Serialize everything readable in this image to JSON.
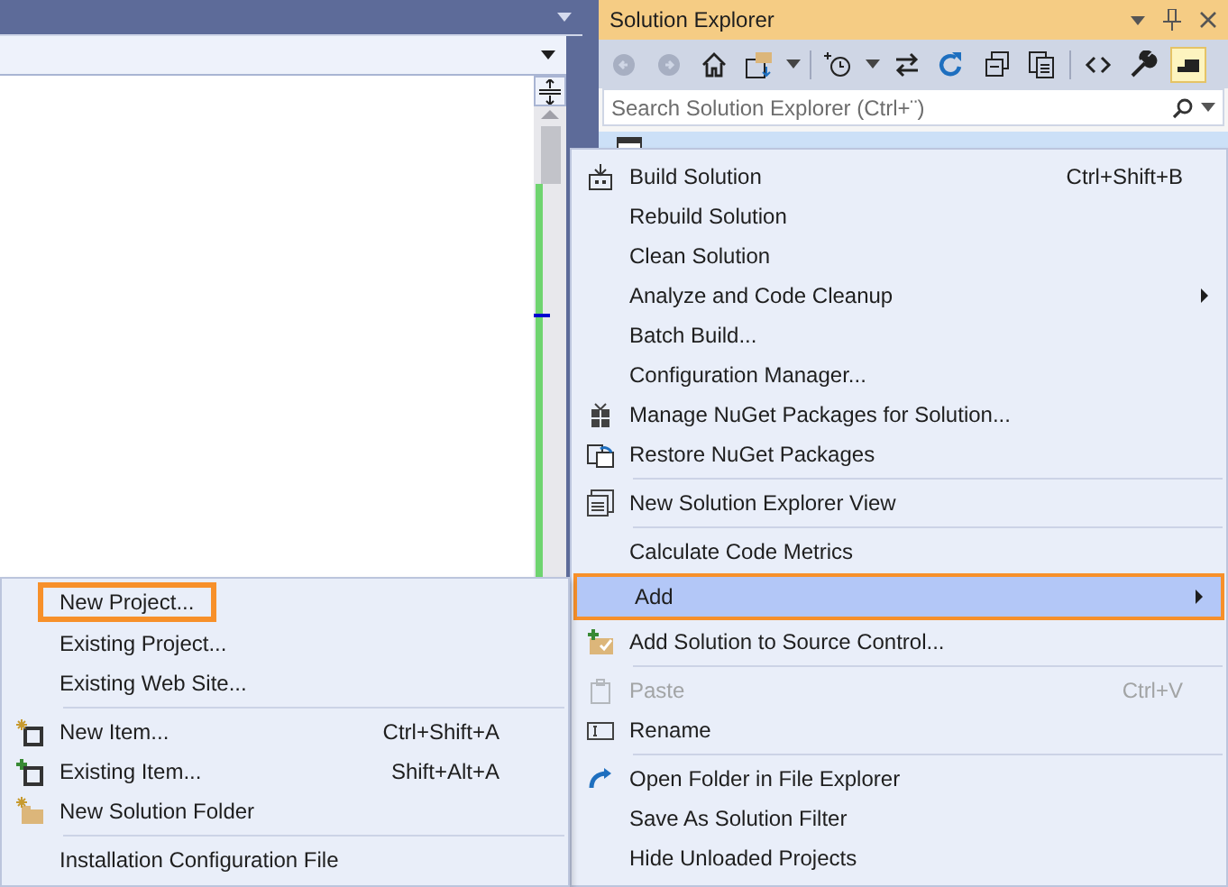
{
  "solution_explorer": {
    "title": "Solution Explorer",
    "search": {
      "placeholder": "Search Solution Explorer (Ctrl+¨)"
    }
  },
  "context_menu": [
    {
      "kind": "item",
      "label": "Build Solution",
      "shortcut": "Ctrl+Shift+B",
      "submenu": false,
      "disabled": false,
      "selected": false,
      "highlighted": false
    },
    {
      "kind": "item",
      "label": "Rebuild Solution",
      "submenu": false,
      "disabled": false,
      "selected": false,
      "highlighted": false
    },
    {
      "kind": "item",
      "label": "Clean Solution",
      "submenu": false,
      "disabled": false,
      "selected": false,
      "highlighted": false
    },
    {
      "kind": "item",
      "label": "Analyze and Code Cleanup",
      "submenu": true,
      "disabled": false,
      "selected": false,
      "highlighted": false
    },
    {
      "kind": "item",
      "label": "Batch Build...",
      "submenu": false,
      "disabled": false,
      "selected": false,
      "highlighted": false
    },
    {
      "kind": "item",
      "label": "Configuration Manager...",
      "submenu": false,
      "disabled": false,
      "selected": false,
      "highlighted": false
    },
    {
      "kind": "item",
      "label": "Manage NuGet Packages for Solution...",
      "submenu": false,
      "disabled": false,
      "selected": false,
      "highlighted": false
    },
    {
      "kind": "item",
      "label": "Restore NuGet Packages",
      "submenu": false,
      "disabled": false,
      "selected": false,
      "highlighted": false
    },
    {
      "kind": "separator"
    },
    {
      "kind": "item",
      "label": "New Solution Explorer View",
      "submenu": false,
      "disabled": false,
      "selected": false,
      "highlighted": false
    },
    {
      "kind": "separator"
    },
    {
      "kind": "item",
      "label": "Calculate Code Metrics",
      "submenu": false,
      "disabled": false,
      "selected": false,
      "highlighted": false
    },
    {
      "kind": "item",
      "label": "Add",
      "submenu": true,
      "disabled": false,
      "selected": true,
      "highlighted": true
    },
    {
      "kind": "item",
      "label": "Add Solution to Source Control...",
      "submenu": false,
      "disabled": false,
      "selected": false,
      "highlighted": false
    },
    {
      "kind": "separator"
    },
    {
      "kind": "item",
      "label": "Paste",
      "shortcut": "Ctrl+V",
      "submenu": false,
      "disabled": true,
      "selected": false,
      "highlighted": false
    },
    {
      "kind": "item",
      "label": "Rename",
      "submenu": false,
      "disabled": false,
      "selected": false,
      "highlighted": false
    },
    {
      "kind": "separator"
    },
    {
      "kind": "item",
      "label": "Open Folder in File Explorer",
      "submenu": false,
      "disabled": false,
      "selected": false,
      "highlighted": false
    },
    {
      "kind": "item",
      "label": "Save As Solution Filter",
      "submenu": false,
      "disabled": false,
      "selected": false,
      "highlighted": false
    },
    {
      "kind": "item",
      "label": "Hide Unloaded Projects",
      "submenu": false,
      "disabled": false,
      "selected": false,
      "highlighted": false
    }
  ],
  "add_submenu": [
    {
      "kind": "item",
      "label": "New Project...",
      "selected": false,
      "highlighted": true
    },
    {
      "kind": "item",
      "label": "Existing Project...",
      "selected": false,
      "highlighted": false
    },
    {
      "kind": "item",
      "label": "Existing Web Site...",
      "selected": false,
      "highlighted": false
    },
    {
      "kind": "separator"
    },
    {
      "kind": "item",
      "label": "New Item...",
      "shortcut": "Ctrl+Shift+A",
      "selected": false,
      "highlighted": false
    },
    {
      "kind": "item",
      "label": "Existing Item...",
      "shortcut": "Shift+Alt+A",
      "selected": false,
      "highlighted": false
    },
    {
      "kind": "item",
      "label": "New Solution Folder",
      "selected": false,
      "highlighted": false
    },
    {
      "kind": "separator"
    },
    {
      "kind": "item",
      "label": "Installation Configuration File",
      "selected": false,
      "highlighted": false
    }
  ]
}
